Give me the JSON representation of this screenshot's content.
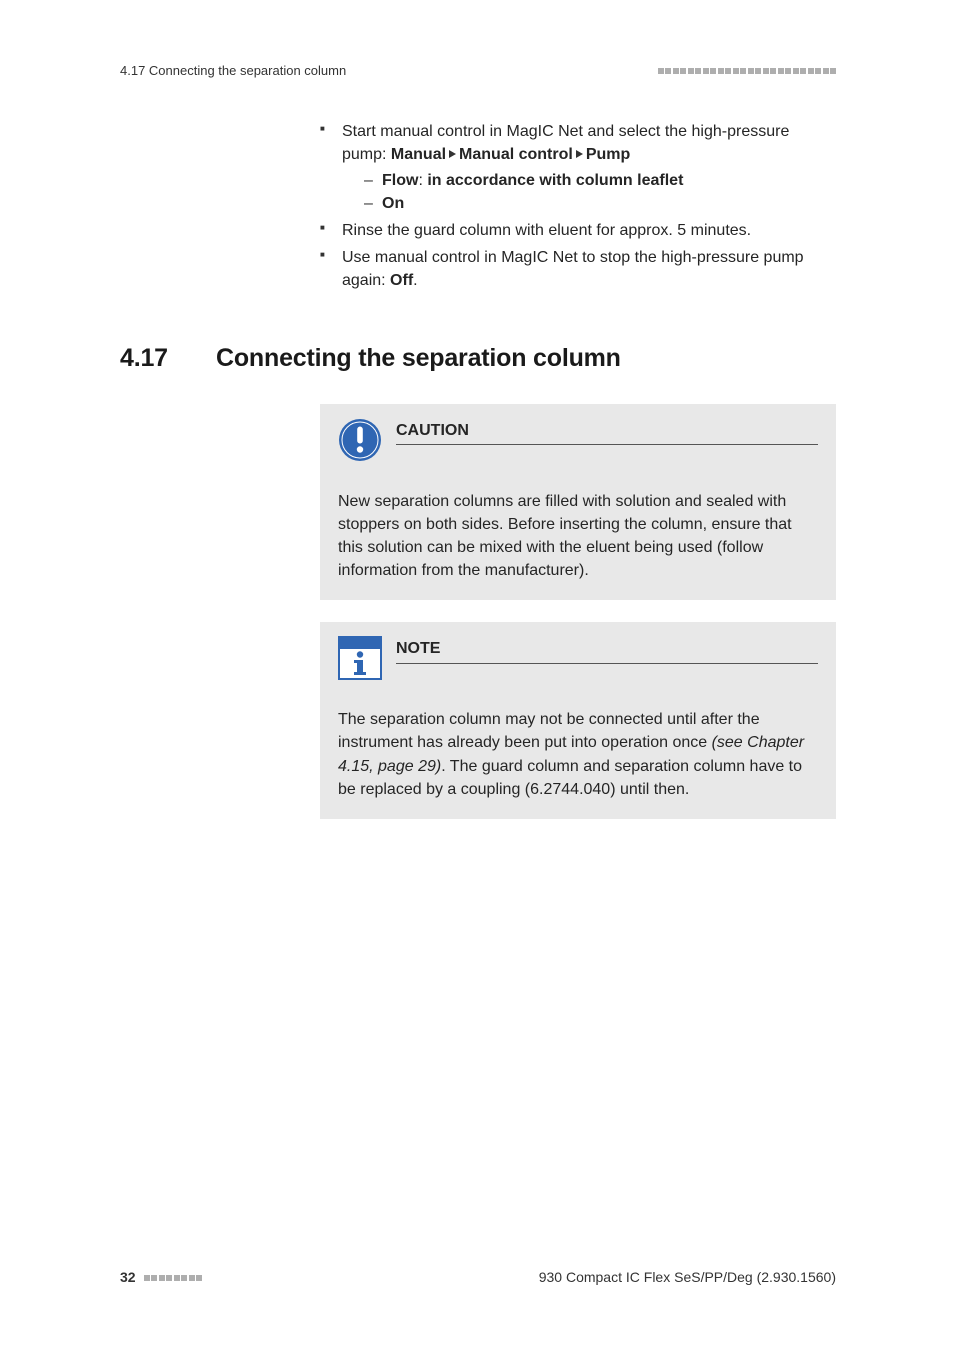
{
  "header": {
    "left": "4.17 Connecting the separation column"
  },
  "steps": {
    "item1_pre": "Start manual control in MagIC Net and select the high-pressure pump: ",
    "item1_path": [
      "Manual",
      "Manual control",
      "Pump"
    ],
    "sub1_label": "Flow",
    "sub1_sep": ": ",
    "sub1_val": "in accordance with column leaflet",
    "sub2_val": "On",
    "item2": "Rinse the guard column with eluent for approx. 5 minutes.",
    "item3_pre": "Use manual control in MagIC Net to stop the high-pressure pump again: ",
    "item3_val": "Off",
    "item3_post": "."
  },
  "section": {
    "num": "4.17",
    "title": "Connecting the separation column"
  },
  "caution": {
    "title": "CAUTION",
    "body": "New separation columns are filled with solution and sealed with stoppers on both sides. Before inserting the column, ensure that this solution can be mixed with the eluent being used (follow information from the manufacturer)."
  },
  "note": {
    "title": "NOTE",
    "body_pre": "The separation column may not be connected until after the instrument has already been put into operation once ",
    "body_em": "(see Chapter 4.15, page 29)",
    "body_post": ". The guard column and separation column have to be replaced by a coupling (6.2744.040) until then."
  },
  "footer": {
    "page": "32",
    "right": "930 Compact IC Flex SeS/PP/Deg (2.930.1560)"
  }
}
